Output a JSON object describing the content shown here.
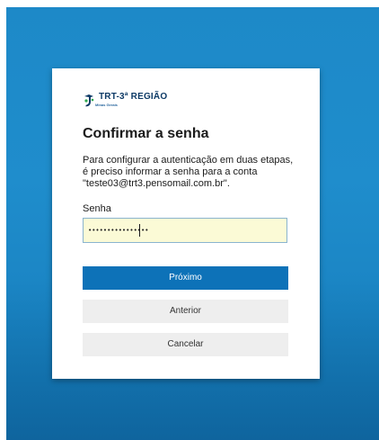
{
  "brand": {
    "logo_title": "TRT-3ª REGIÃO",
    "logo_subtitle": "Minas Gerais",
    "accent_color": "#0d72b8"
  },
  "dialog": {
    "title": "Confirmar a senha",
    "description": "Para configurar a autenticação em duas etapas, é preciso informar a senha para a conta \"teste03@trt3.pensomail.com.br\".",
    "password_label": "Senha",
    "password_value": "••••••••••••••••",
    "buttons": {
      "next": "Próximo",
      "back": "Anterior",
      "cancel": "Cancelar"
    }
  }
}
